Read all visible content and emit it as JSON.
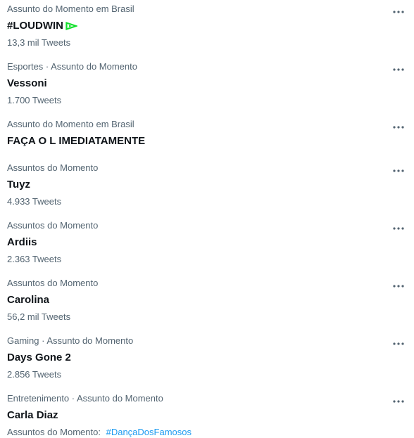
{
  "trends": [
    {
      "context": "Assunto do Momento em Brasil",
      "name": "#LOUDWIN",
      "meta": "13,3 mil Tweets",
      "has_flag_icon": true,
      "flag_icon": "loud-logo-icon",
      "flag_color": "#13e02c"
    },
    {
      "context": "Esportes · Assunto do Momento",
      "name": "Vessoni",
      "meta": "1.700 Tweets"
    },
    {
      "context": "Assunto do Momento em Brasil",
      "name": "FAÇA O L IMEDIATAMENTE",
      "meta": ""
    },
    {
      "context": "Assuntos do Momento",
      "name": "Tuyz",
      "meta": "4.933 Tweets"
    },
    {
      "context": "Assuntos do Momento",
      "name": "Ardiis",
      "meta": "2.363 Tweets"
    },
    {
      "context": "Assuntos do Momento",
      "name": "Carolina",
      "meta": "56,2 mil Tweets"
    },
    {
      "context": "Gaming · Assunto do Momento",
      "name": "Days Gone 2",
      "meta": "2.856 Tweets"
    },
    {
      "context": "Entretenimento · Assunto do Momento",
      "name": "Carla Diaz",
      "meta_prefix": "Assuntos do Momento:",
      "meta_hashtag": "#DançaDosFamosos"
    }
  ],
  "more_icon": "more-horizontal-icon",
  "colors": {
    "primary_text": "#0f1419",
    "secondary_text": "#536471",
    "link": "#1d9bf0"
  }
}
